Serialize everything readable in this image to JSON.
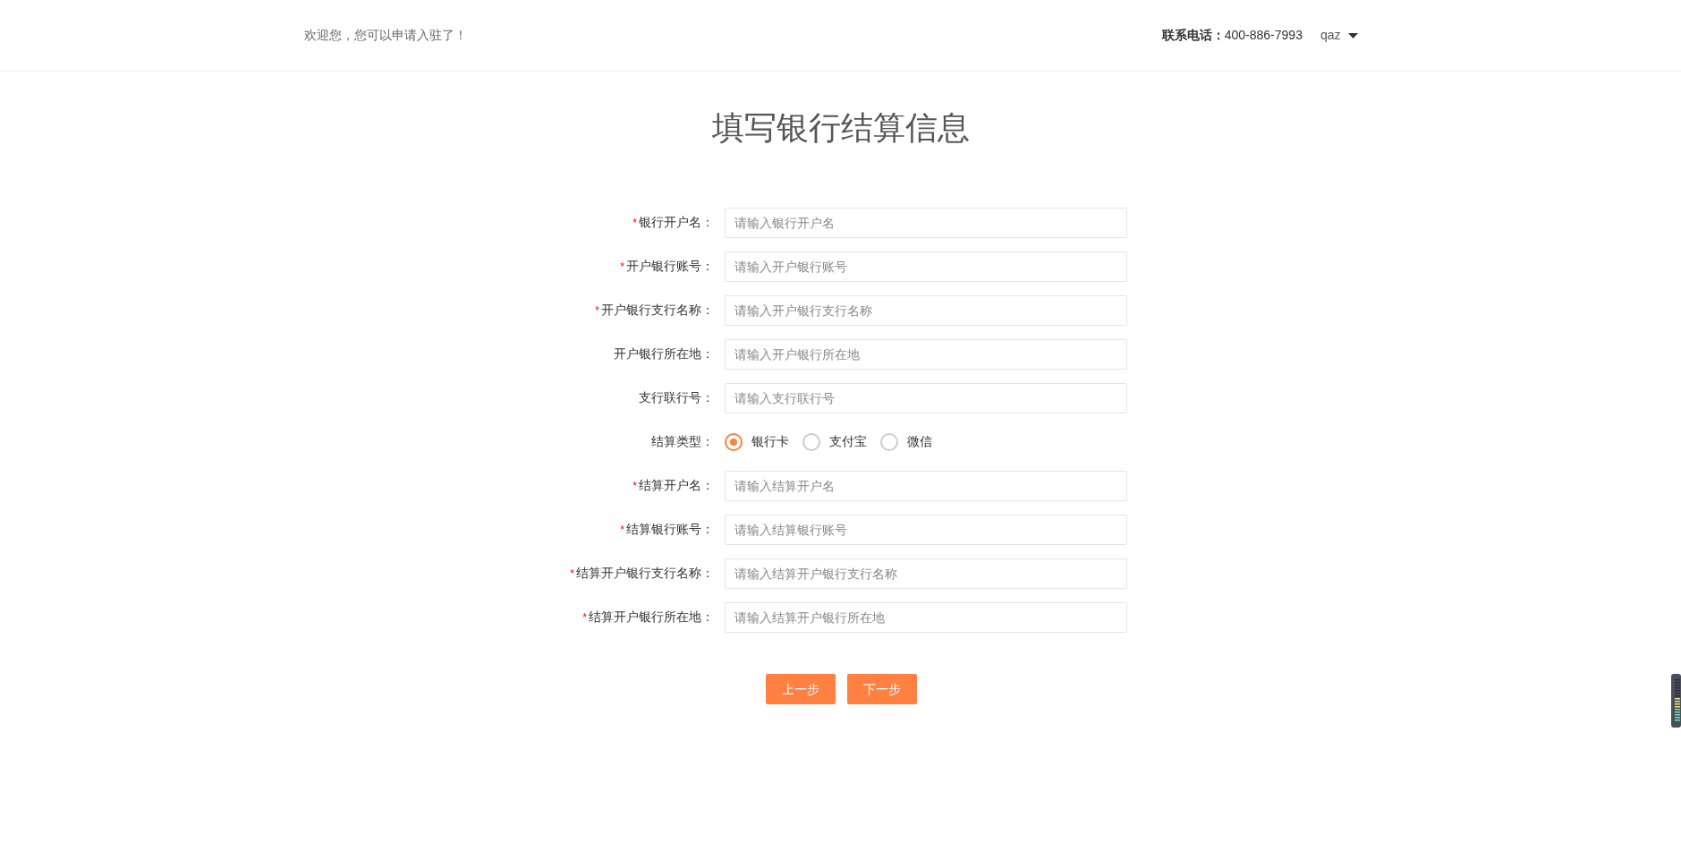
{
  "header": {
    "welcome": "欢迎您，您可以申请入驻了！",
    "phone_label": "联系电话：",
    "phone": "400-886-7993",
    "user": "qaz"
  },
  "title": "填写银行结算信息",
  "fields": [
    {
      "kind": "text",
      "required_mark": "*",
      "label": "银行开户名：",
      "placeholder": "请输入银行开户名"
    },
    {
      "kind": "text",
      "required_mark": "*",
      "label": "开户银行账号：",
      "placeholder": "请输入开户银行账号"
    },
    {
      "kind": "text",
      "required_mark": "*",
      "label": "开户银行支行名称：",
      "placeholder": "请输入开户银行支行名称"
    },
    {
      "kind": "text",
      "label": "开户银行所在地：",
      "placeholder": "请输入开户银行所在地"
    },
    {
      "kind": "text",
      "label": "支行联行号：",
      "placeholder": "请输入支行联行号"
    },
    {
      "kind": "radio",
      "label": "结算类型：",
      "options": [
        {
          "label": "银行卡",
          "selected": true
        },
        {
          "label": "支付宝",
          "selected": false
        },
        {
          "label": "微信",
          "selected": false
        }
      ]
    },
    {
      "kind": "text",
      "required_mark": "*",
      "label": "结算开户名：",
      "placeholder": "请输入结算开户名"
    },
    {
      "kind": "text",
      "required_mark": "*",
      "label": "结算银行账号：",
      "placeholder": "请输入结算银行账号"
    },
    {
      "kind": "text",
      "required_mark": "*",
      "label": "结算开户银行支行名称：",
      "placeholder": "请输入结算开户银行支行名称"
    },
    {
      "kind": "text",
      "required_mark": "*",
      "label": "结算开户银行所在地：",
      "placeholder": "请输入结算开户银行所在地"
    }
  ],
  "buttons": [
    "上一步",
    "下一步"
  ]
}
